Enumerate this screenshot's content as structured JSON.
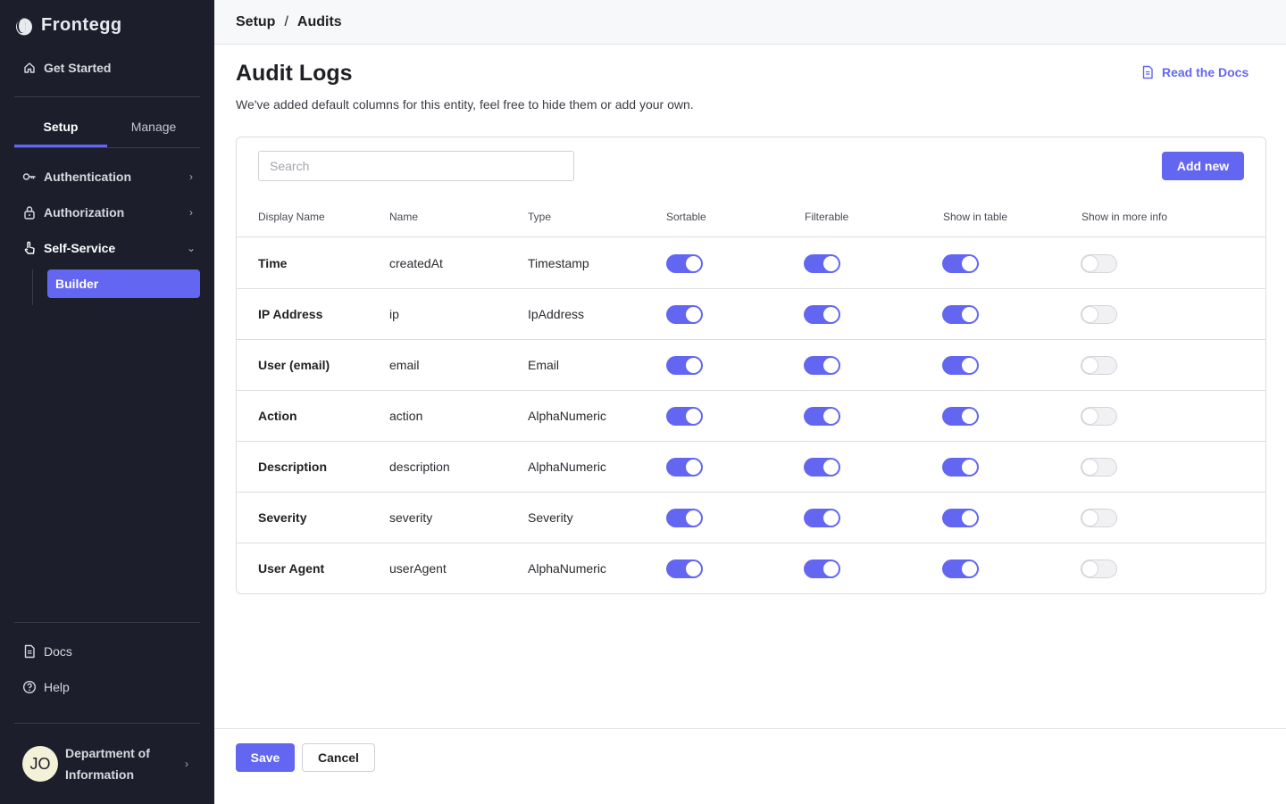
{
  "app": {
    "brand": "Frontegg"
  },
  "sidebar": {
    "get_started": "Get Started",
    "tabs": [
      {
        "label": "Setup",
        "active": true
      },
      {
        "label": "Manage",
        "active": false
      }
    ],
    "items": [
      {
        "label": "Authentication",
        "icon": "key-icon"
      },
      {
        "label": "Authorization",
        "icon": "lock-icon"
      },
      {
        "label": "Self-Service",
        "icon": "touch-icon"
      }
    ],
    "sub_item": "Builder",
    "docs": "Docs",
    "help": "Help",
    "account": {
      "initials": "JO",
      "name": "Department of Information"
    }
  },
  "breadcrumb": {
    "parent": "Setup",
    "separator": "/",
    "current": "Audits"
  },
  "page": {
    "title": "Audit Logs",
    "subtitle": "We've added default columns for this entity, feel free to hide them or add your own.",
    "docs_link": "Read the Docs"
  },
  "table": {
    "search_placeholder": "Search",
    "add_button": "Add new",
    "columns": [
      "Display Name",
      "Name",
      "Type",
      "Sortable",
      "Filterable",
      "Show in table",
      "Show in more info"
    ],
    "rows": [
      {
        "display": "Time",
        "name": "createdAt",
        "type": "Timestamp",
        "sortable": true,
        "filterable": true,
        "show_in_table": true,
        "show_in_more_info": false
      },
      {
        "display": "IP Address",
        "name": "ip",
        "type": "IpAddress",
        "sortable": true,
        "filterable": true,
        "show_in_table": true,
        "show_in_more_info": false
      },
      {
        "display": "User (email)",
        "name": "email",
        "type": "Email",
        "sortable": true,
        "filterable": true,
        "show_in_table": true,
        "show_in_more_info": false
      },
      {
        "display": "Action",
        "name": "action",
        "type": "AlphaNumeric",
        "sortable": true,
        "filterable": true,
        "show_in_table": true,
        "show_in_more_info": false
      },
      {
        "display": "Description",
        "name": "description",
        "type": "AlphaNumeric",
        "sortable": true,
        "filterable": true,
        "show_in_table": true,
        "show_in_more_info": false
      },
      {
        "display": "Severity",
        "name": "severity",
        "type": "Severity",
        "sortable": true,
        "filterable": true,
        "show_in_table": true,
        "show_in_more_info": false
      },
      {
        "display": "User Agent",
        "name": "userAgent",
        "type": "AlphaNumeric",
        "sortable": true,
        "filterable": true,
        "show_in_table": true,
        "show_in_more_info": false
      }
    ]
  },
  "footer": {
    "save": "Save",
    "cancel": "Cancel"
  },
  "colors": {
    "accent": "#6366f1",
    "sidebar_bg": "#1d1e2c"
  }
}
